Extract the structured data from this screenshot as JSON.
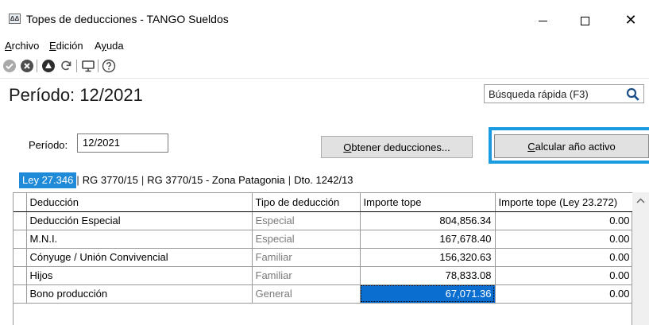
{
  "window": {
    "title": "Topes de deducciones - TANGO Sueldos",
    "app_icon_text": "ΔΔ"
  },
  "menu": {
    "items": [
      {
        "label": "Archivo",
        "accel": "A",
        "rest": "rchivo"
      },
      {
        "label": "Edición",
        "accel": "E",
        "rest": "dición"
      },
      {
        "label": "Ayuda",
        "pre": "A",
        "accel": "y",
        "rest": "uda"
      }
    ]
  },
  "toolbar": {
    "icons": [
      "check-circle-icon",
      "cancel-circle-icon",
      "warning-triangle-icon",
      "refresh-icon",
      "monitor-icon",
      "help-icon"
    ]
  },
  "header": {
    "period_title": "Período: 12/2021",
    "search_placeholder": "Búsqueda rápida (F3)"
  },
  "form": {
    "period_label": "Período:",
    "period_value": "12/2021",
    "obtener_accel": "O",
    "obtener_rest": "btener deducciones...",
    "calcular_accel": "C",
    "calcular_rest": "alcular año activo"
  },
  "tabs": [
    {
      "label": "Ley 27.346",
      "active": true
    },
    {
      "label": "RG 3770/15",
      "active": false
    },
    {
      "label": "RG 3770/15 - Zona Patagonia",
      "active": false
    },
    {
      "label": "Dto. 1242/13",
      "active": false
    }
  ],
  "grid": {
    "columns": [
      "Deducción",
      "Tipo de deducción",
      "Importe tope",
      "Importe tope (Ley 23.272)"
    ],
    "rows": [
      {
        "deduccion": "Deducción Especial",
        "tipo": "Especial",
        "importe": "804,856.34",
        "importe_ley": "0.00"
      },
      {
        "deduccion": "M.N.I.",
        "tipo": "Especial",
        "importe": "167,678.40",
        "importe_ley": "0.00"
      },
      {
        "deduccion": "Cónyuge / Unión Convivencial",
        "tipo": "Familiar",
        "importe": "156,320.63",
        "importe_ley": "0.00"
      },
      {
        "deduccion": "Hijos",
        "tipo": "Familiar",
        "importe": "78,833.08",
        "importe_ley": "0.00"
      },
      {
        "deduccion": "Bono producción",
        "tipo": "General",
        "importe": "67,071.36",
        "importe_ley": "0.00"
      }
    ]
  },
  "colors": {
    "tab_active": "#1f8ad8",
    "highlight_border": "#1a9be0",
    "selected_cell": "#0a6ed1"
  }
}
